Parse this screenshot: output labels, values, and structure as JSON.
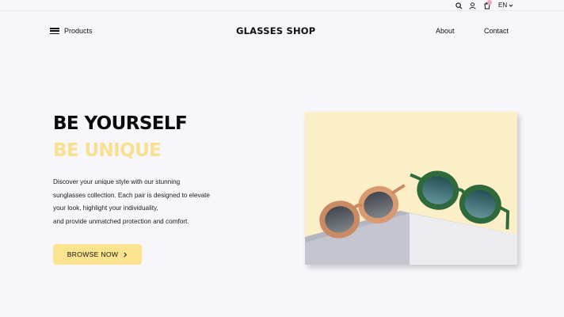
{
  "topbar": {
    "icons": [
      "search-icon",
      "user-icon",
      "cart-icon"
    ],
    "language": "EN"
  },
  "nav": {
    "products_label": "Products",
    "brand": "GLASSES SHOP",
    "about_label": "About",
    "contact_label": "Contact"
  },
  "hero": {
    "title_line1": "BE YOURSELF",
    "title_line2": "BE UNIQUE",
    "description": [
      "Discover your unique style with our stunning",
      "sunglasses collection. Each pair is designed to elevate",
      "your look, highlight your individuality,",
      "and provide unmatched protection and comfort."
    ],
    "cta_label": "BROWSE NOW"
  },
  "colors": {
    "background": "#f7f6fb",
    "accent_yellow": "#fbe38f",
    "title_dark": "#0b0b0b",
    "title_light": "#f9e08f",
    "photo_bg": "#fcefc7"
  }
}
